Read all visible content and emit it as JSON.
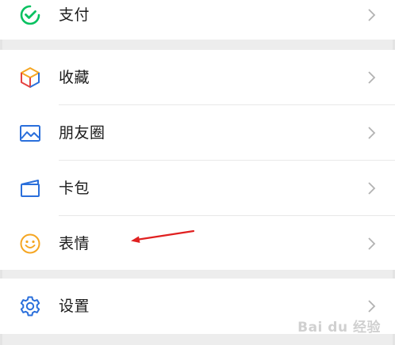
{
  "menu": {
    "pay": {
      "label": "支付",
      "icon": "wechat-pay-icon"
    },
    "favorites": {
      "label": "收藏",
      "icon": "cube-icon"
    },
    "moments": {
      "label": "朋友圈",
      "icon": "picture-icon"
    },
    "cards": {
      "label": "卡包",
      "icon": "card-wallet-icon"
    },
    "stickers": {
      "label": "表情",
      "icon": "smiley-icon"
    },
    "settings": {
      "label": "设置",
      "icon": "gear-icon"
    }
  },
  "colors": {
    "background": "#ededed",
    "row": "#ffffff",
    "text": "#1a1a1a",
    "chevron": "#b2b2b2",
    "pay_green": "#07c160",
    "icon_blue": "#2a6fdb",
    "sticker_orange": "#f5a623",
    "annotation_red": "#e02020"
  },
  "watermark": {
    "text": "Bai du 经验"
  }
}
